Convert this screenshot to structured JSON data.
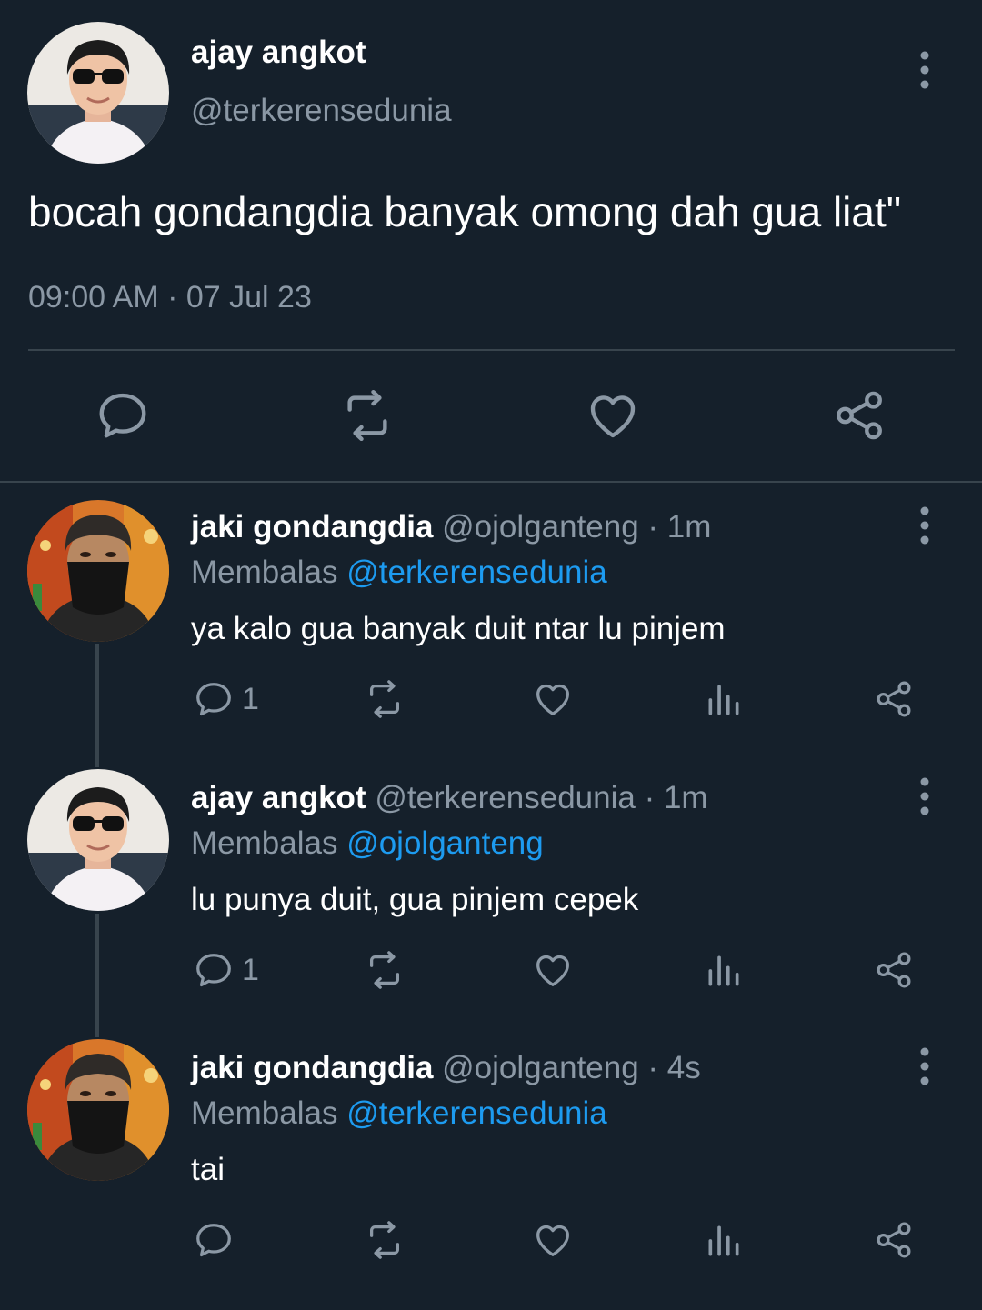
{
  "colors": {
    "background": "#15202b",
    "text": "#ffffff",
    "muted": "#8b98a5",
    "link": "#1d9bf0",
    "divider": "#38444d"
  },
  "main_tweet": {
    "author_name": "ajay angkot",
    "author_handle": "@terkerensedunia",
    "text": "bocah gondangdia banyak omong dah gua liat\"",
    "timestamp": "09:00 AM · 07 Jul 23",
    "actions": [
      "reply-icon",
      "retweet-icon",
      "like-icon",
      "share-icon"
    ]
  },
  "replies": [
    {
      "author_name": "jaki gondangdia",
      "meta": "@ojolganteng · 1m",
      "replying_prefix": "Membalas",
      "replying_to": "@terkerensedunia",
      "text": "ya kalo gua banyak duit ntar lu pinjem",
      "reply_count": "1",
      "avatar": "masked-man-avatar"
    },
    {
      "author_name": "ajay angkot",
      "meta": "@terkerensedunia · 1m",
      "replying_prefix": "Membalas",
      "replying_to": "@ojolganteng",
      "text": "lu punya duit, gua pinjem cepek",
      "reply_count": "1",
      "avatar": "sunglasses-man-avatar"
    },
    {
      "author_name": "jaki gondangdia",
      "meta": "@ojolganteng · 4s",
      "replying_prefix": "Membalas",
      "replying_to": "@terkerensedunia",
      "text": "tai",
      "reply_count": "",
      "avatar": "masked-man-avatar"
    }
  ]
}
